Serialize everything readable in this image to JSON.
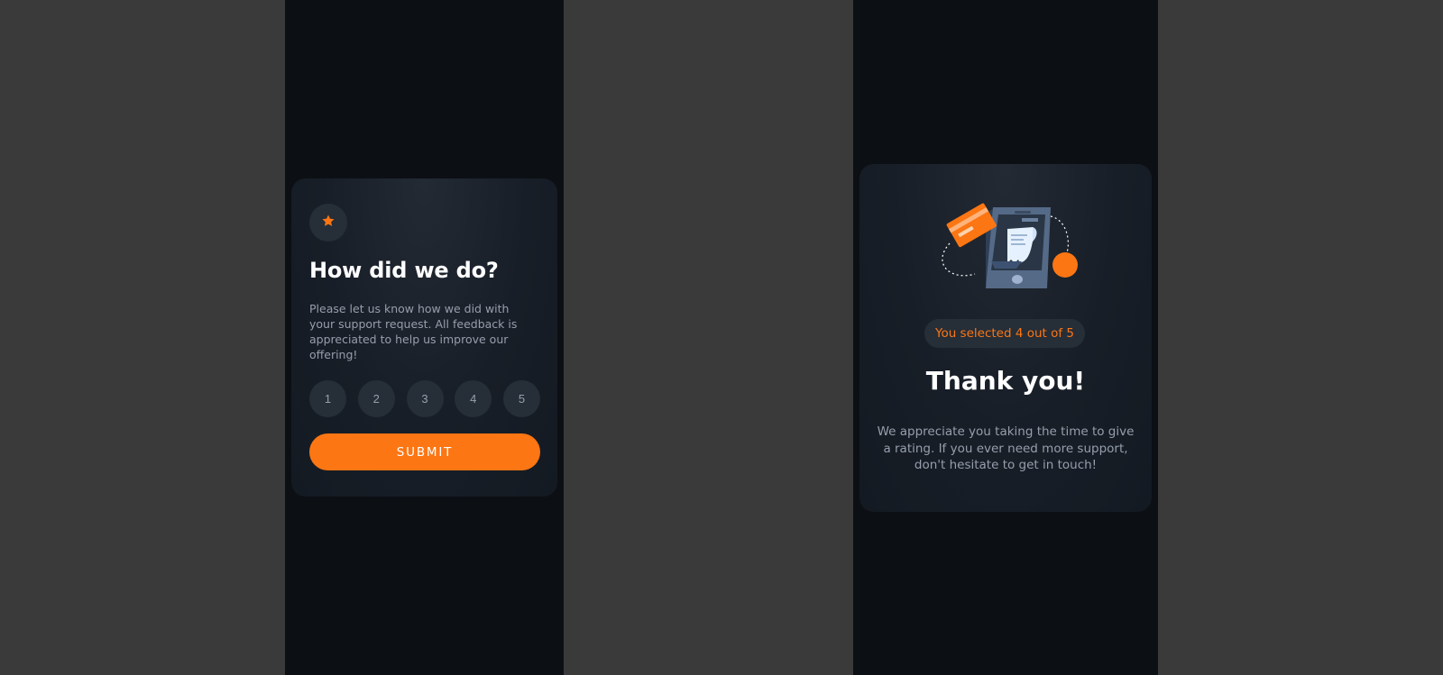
{
  "rating_card": {
    "title": "How did we do?",
    "description": "Please let us know how we did with your support request. All feedback is appreciated to help us improve our offering!",
    "options": [
      "1",
      "2",
      "3",
      "4",
      "5"
    ],
    "submit_label": "SUBMIT"
  },
  "thank_you_card": {
    "selected_text": "You selected 4 out of 5",
    "title": "Thank you!",
    "description": "We appreciate you taking the time to give a rating. If you ever need more support, don't hesitate to get in touch!"
  },
  "colors": {
    "accent": "#fc7613",
    "page_bg": "#3a3a3a",
    "panel_bg": "#0c0f14",
    "card_bg": "#181e27",
    "chip_bg": "#262e38",
    "muted_text": "#969fad",
    "heading_text": "#ffffff"
  },
  "icons": {
    "badge": "star-icon",
    "illustration": "payment-receipt-illustration"
  }
}
